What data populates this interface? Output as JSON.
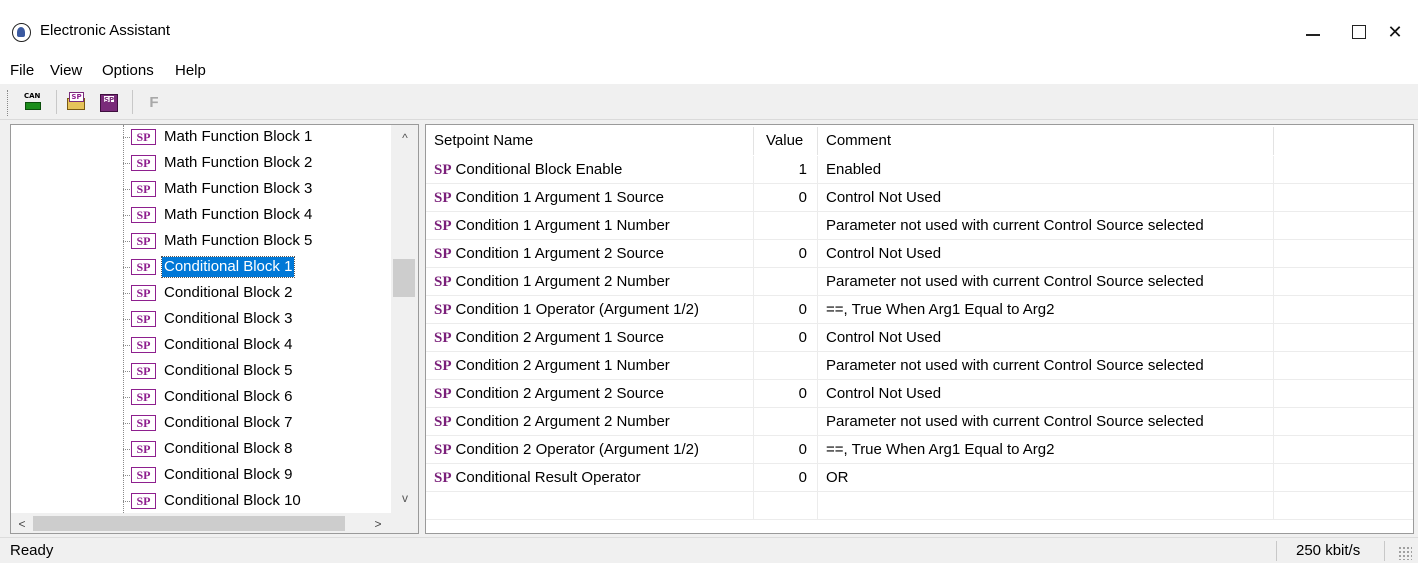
{
  "window": {
    "title": "Electronic Assistant",
    "icon": "app-logo-icon",
    "minimize_icon": "minimize-icon",
    "maximize_icon": "maximize-icon",
    "close_glyph": "✕"
  },
  "menu": [
    "File",
    "View",
    "Options",
    "Help"
  ],
  "toolbar": {
    "can_icon": "can-connect-icon",
    "can_text": "CAN",
    "open_icon": "open-setpoint-file-icon",
    "open_text": "SP",
    "save_icon": "save-setpoint-file-icon",
    "save_text": "SP",
    "flash_label": "F"
  },
  "tree": {
    "badge": "SP",
    "items": [
      "Math Function Block 1",
      "Math Function Block 2",
      "Math Function Block 3",
      "Math Function Block 4",
      "Math Function Block 5",
      "Conditional Block 1",
      "Conditional Block 2",
      "Conditional Block 3",
      "Conditional Block 4",
      "Conditional Block 5",
      "Conditional Block 6",
      "Conditional Block 7",
      "Conditional Block 8",
      "Conditional Block 9",
      "Conditional Block 10"
    ],
    "selected": "Conditional Block 1",
    "scroll": {
      "up": "^",
      "down": "v",
      "left": "<",
      "right": ">"
    }
  },
  "grid": {
    "headers": {
      "name": "Setpoint Name",
      "value": "Value",
      "comment": "Comment"
    },
    "badge": "SP",
    "rows": [
      {
        "name": "Conditional Block Enable",
        "value": "1",
        "comment": "Enabled"
      },
      {
        "name": "Condition 1 Argument 1 Source",
        "value": "0",
        "comment": "Control Not Used"
      },
      {
        "name": "Condition 1 Argument 1 Number",
        "value": "",
        "comment": "Parameter not used with current Control Source selected"
      },
      {
        "name": "Condition 1 Argument 2 Source",
        "value": "0",
        "comment": "Control Not Used"
      },
      {
        "name": "Condition 1 Argument 2 Number",
        "value": "",
        "comment": "Parameter not used with current Control Source selected"
      },
      {
        "name": "Condition 1 Operator (Argument 1/2)",
        "value": "0",
        "comment": "==, True When Arg1 Equal to Arg2"
      },
      {
        "name": "Condition 2 Argument 1 Source",
        "value": "0",
        "comment": "Control Not Used"
      },
      {
        "name": "Condition 2 Argument 1 Number",
        "value": "",
        "comment": "Parameter not used with current Control Source selected"
      },
      {
        "name": "Condition 2 Argument 2 Source",
        "value": "0",
        "comment": "Control Not Used"
      },
      {
        "name": "Condition 2 Argument 2 Number",
        "value": "",
        "comment": "Parameter not used with current Control Source selected"
      },
      {
        "name": "Condition 2 Operator (Argument 1/2)",
        "value": "0",
        "comment": "==, True When Arg1 Equal to Arg2"
      },
      {
        "name": "Conditional Result Operator",
        "value": "0",
        "comment": "OR"
      }
    ]
  },
  "status": {
    "text": "Ready",
    "bitrate": "250 kbit/s"
  }
}
